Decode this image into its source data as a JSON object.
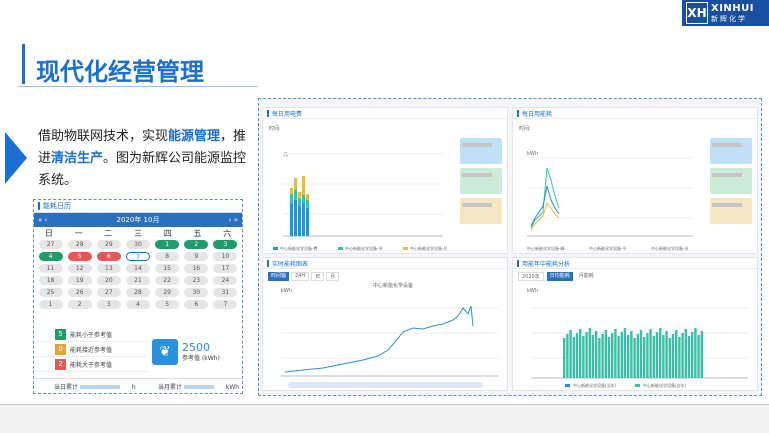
{
  "logo": {
    "mark": "XH",
    "en": "XINHUI",
    "cn": "新辉化学"
  },
  "title": "现代化经营管理",
  "description": {
    "parts": [
      {
        "text": "借助物联网技术，实现",
        "hl": false
      },
      {
        "text": "能源管理",
        "hl": true
      },
      {
        "text": "，推进",
        "hl": false
      },
      {
        "text": "清洁生产",
        "hl": true
      },
      {
        "text": "。图为新辉公司能源监控系统。",
        "hl": false
      }
    ]
  },
  "calendar": {
    "header": "能耗日历",
    "nav_prev": "« ‹",
    "month": "2020年 10月",
    "nav_next": "› »",
    "weekdays": [
      "日",
      "一",
      "二",
      "三",
      "四",
      "五",
      "六"
    ],
    "days": [
      {
        "d": "27",
        "s": ""
      },
      {
        "d": "28",
        "s": ""
      },
      {
        "d": "29",
        "s": ""
      },
      {
        "d": "30",
        "s": ""
      },
      {
        "d": "1",
        "s": "g"
      },
      {
        "d": "2",
        "s": "g"
      },
      {
        "d": "3",
        "s": "g"
      },
      {
        "d": "4",
        "s": "g"
      },
      {
        "d": "5",
        "s": "r"
      },
      {
        "d": "6",
        "s": "r"
      },
      {
        "d": "7",
        "s": "o"
      },
      {
        "d": "8",
        "s": ""
      },
      {
        "d": "9",
        "s": ""
      },
      {
        "d": "10",
        "s": ""
      },
      {
        "d": "11",
        "s": ""
      },
      {
        "d": "12",
        "s": ""
      },
      {
        "d": "13",
        "s": ""
      },
      {
        "d": "14",
        "s": ""
      },
      {
        "d": "15",
        "s": ""
      },
      {
        "d": "16",
        "s": ""
      },
      {
        "d": "17",
        "s": ""
      },
      {
        "d": "18",
        "s": ""
      },
      {
        "d": "19",
        "s": ""
      },
      {
        "d": "20",
        "s": ""
      },
      {
        "d": "21",
        "s": ""
      },
      {
        "d": "22",
        "s": ""
      },
      {
        "d": "23",
        "s": ""
      },
      {
        "d": "24",
        "s": ""
      },
      {
        "d": "25",
        "s": ""
      },
      {
        "d": "26",
        "s": ""
      },
      {
        "d": "27",
        "s": ""
      },
      {
        "d": "28",
        "s": ""
      },
      {
        "d": "29",
        "s": ""
      },
      {
        "d": "30",
        "s": ""
      },
      {
        "d": "31",
        "s": ""
      },
      {
        "d": "1",
        "s": ""
      },
      {
        "d": "2",
        "s": ""
      },
      {
        "d": "3",
        "s": ""
      },
      {
        "d": "4",
        "s": ""
      },
      {
        "d": "5",
        "s": ""
      },
      {
        "d": "6",
        "s": ""
      },
      {
        "d": "7",
        "s": ""
      }
    ],
    "legend": [
      {
        "num": "5",
        "label": "能耗小于参考值",
        "color": "#1e9c6c"
      },
      {
        "num": "0",
        "label": "能耗接近参考值",
        "color": "#e8a23a"
      },
      {
        "num": "2",
        "label": "能耗大于参考值",
        "color": "#e05a5a"
      }
    ],
    "reference_value": "2500",
    "reference_label": "参考值",
    "reference_unit": "(kWh)",
    "footer_day": "当日累计",
    "footer_day_unit": "h",
    "footer_month": "当月累计",
    "footer_month_unit": "kWh"
  },
  "dashboard": {
    "panel1": {
      "title": "每日用电费",
      "filter": "时间:",
      "unit": "元",
      "legend": [
        "中心新能化学设备-费",
        "中心新能化学设备-节",
        "中心新能化学设备-总"
      ]
    },
    "panel2": {
      "title": "每日用能耗",
      "filter": "时间:",
      "unit": "kWh",
      "legend": [
        "中心新能化学设备-峰",
        "中心新能化学设备-平",
        "中心新能化学设备-谷"
      ]
    },
    "panel3": {
      "title": "实时能耗图表",
      "tabs": [
        "时间轴",
        "24H",
        "日",
        "月"
      ],
      "unit": "kWh",
      "legend": "中心新能化学设备"
    },
    "panel4": {
      "title": "用能年中能耗分析",
      "year": "2020年",
      "btn": "日均能耗",
      "btn2": "月能耗",
      "unit": "kWh",
      "legend": [
        "中心新能化学设备(当年)",
        "中心新能化学设备(去年)"
      ]
    }
  },
  "colors": {
    "brand": "#1a6fd0",
    "green": "#1e9c6c",
    "red": "#e05a5a",
    "teal": "#3dbfa6",
    "blue": "#2b8fd9"
  }
}
